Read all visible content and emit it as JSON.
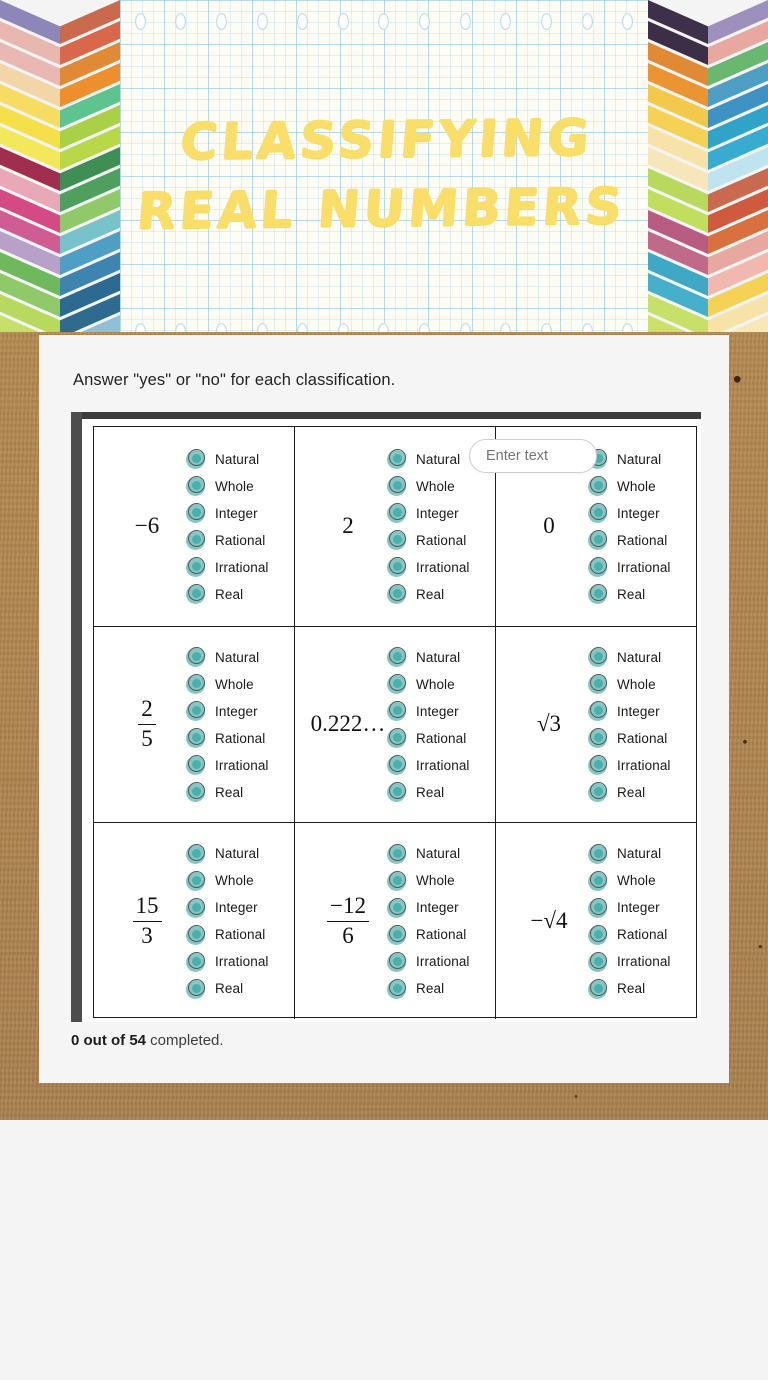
{
  "hero": {
    "title": "Classifying Real Numbers",
    "title_color": "#fade6a",
    "paper_color": "#fdfdf5"
  },
  "main": {
    "instructions": "Answer \"yes\" or \"no\" for each classification.",
    "progress_count": "0 out of 54",
    "progress_suffix": " completed.",
    "text_input_placeholder": "Enter text",
    "text_input_value": ""
  },
  "worksheet": {
    "option_labels": [
      "Natural",
      "Whole",
      "Integer",
      "Rational",
      "Irrational",
      "Real"
    ],
    "bullet_color": "#86c7c4",
    "bullet_dot_color": "#49b0ad",
    "cells": [
      {
        "id": "cell-1",
        "display": "−6",
        "kind": "plain"
      },
      {
        "id": "cell-2",
        "display": "2",
        "kind": "plain"
      },
      {
        "id": "cell-3",
        "display": "0",
        "kind": "plain"
      },
      {
        "id": "cell-4",
        "numerator": "2",
        "denominator": "5",
        "kind": "fraction"
      },
      {
        "id": "cell-5",
        "display": "0.222…",
        "kind": "plain"
      },
      {
        "id": "cell-6",
        "display": "√3",
        "kind": "plain"
      },
      {
        "id": "cell-7",
        "numerator": "15",
        "denominator": "3",
        "kind": "fraction"
      },
      {
        "id": "cell-8",
        "numerator": "−12",
        "denominator": "6",
        "kind": "fraction"
      },
      {
        "id": "cell-9",
        "display": "−√4",
        "kind": "plain"
      }
    ]
  },
  "chevrons": {
    "left": [
      [
        "#8d86b8",
        "#c96a4f"
      ],
      [
        "#e8b8b0",
        "#d9674a"
      ],
      [
        "#eab8b2",
        "#e08a36"
      ],
      [
        "#f2d6a8",
        "#ec8f2c"
      ],
      [
        "#f6dc62",
        "#5ec48f"
      ],
      [
        "#f6e04a",
        "#a9d046"
      ],
      [
        "#f2e85a",
        "#b8d84a"
      ],
      [
        "#a02e4e",
        "#3f8f54"
      ],
      [
        "#e8a8b8",
        "#4fa05e"
      ],
      [
        "#d44a84",
        "#8fc96a"
      ],
      [
        "#cf5c92",
        "#78c3c9"
      ],
      [
        "#b8a0c8",
        "#4f9fc4"
      ],
      [
        "#70b85e",
        "#3d84b0"
      ],
      [
        "#8fc96a",
        "#2d6a92"
      ],
      [
        "#b9d95e",
        "#2f6a8f"
      ],
      [
        "#c6e06a",
        "#8fc0d8"
      ],
      [
        "#cde06a",
        "#c96a4f"
      ],
      [
        "#a8d464",
        "#d86a48"
      ]
    ],
    "right": [
      [
        "#3e2f4a",
        "#9e90bd"
      ],
      [
        "#3d2e48",
        "#e8a8a0"
      ],
      [
        "#e08a36",
        "#6ab86f"
      ],
      [
        "#ea9434",
        "#4f9fc4"
      ],
      [
        "#f2c94a",
        "#3e93c4"
      ],
      [
        "#f5d255",
        "#2fa3c8"
      ],
      [
        "#f7e2a8",
        "#38abd0"
      ],
      [
        "#f7e6ba",
        "#bfe3ef"
      ],
      [
        "#b9d95e",
        "#c96a4f"
      ],
      [
        "#c1de5e",
        "#cf5a3d"
      ],
      [
        "#b95c82",
        "#d8713f"
      ],
      [
        "#c06a8a",
        "#e8a8a0"
      ],
      [
        "#3fa8c4",
        "#f0b8ae"
      ],
      [
        "#46b0ca",
        "#f5d255"
      ],
      [
        "#c6e06a",
        "#f7e2a8"
      ],
      [
        "#cde06a",
        "#f8e8b8"
      ],
      [
        "#c9b9e0",
        "#f6e04a"
      ],
      [
        "#c4b2dc",
        "#f2e85a"
      ],
      [
        "#6fc08a",
        "#5f9e49"
      ],
      [
        "#f6e04a",
        "#58a043"
      ],
      [
        "#b8e8c8",
        "#4f9440"
      ]
    ]
  }
}
